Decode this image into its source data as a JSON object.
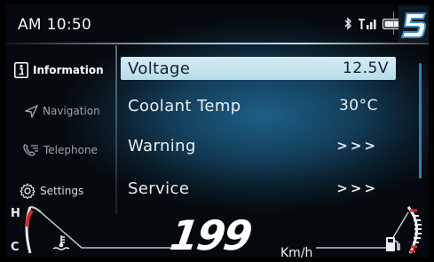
{
  "status": {
    "time": "AM 10:50",
    "icons": [
      "bluetooth-icon",
      "signal-icon",
      "battery-icon"
    ],
    "gear_badge_icon": "gear-indicator-5-icon",
    "gear_digit": "5"
  },
  "sidebar": {
    "items": [
      {
        "label": "Information",
        "icon": "info-icon",
        "active": true
      },
      {
        "label": "Navigation",
        "icon": "navigation-arrow-icon",
        "active": false
      },
      {
        "label": "Telephone",
        "icon": "phone-icon",
        "active": false
      },
      {
        "label": "Settings",
        "icon": "gear-icon",
        "active": false
      }
    ]
  },
  "info_list": {
    "rows": [
      {
        "label": "Voltage",
        "value": "12.5V",
        "selected": true
      },
      {
        "label": "Coolant Temp",
        "value": "30°C",
        "selected": false
      },
      {
        "label": "Warning",
        "value": ">>>",
        "selected": false
      },
      {
        "label": "Service",
        "value": ">>>",
        "selected": false
      }
    ]
  },
  "gauges": {
    "temp_high_label": "H",
    "temp_low_label": "C",
    "temp_icon": "coolant-temp-icon",
    "fuel_icon": "fuel-pump-icon",
    "speed_value": "199",
    "speed_unit": "Km/h"
  },
  "colors": {
    "accent": "#2f7fb3",
    "selected_row": "#c6e3ef",
    "warning_red": "#d62a2a",
    "background": "#0a1c29"
  }
}
